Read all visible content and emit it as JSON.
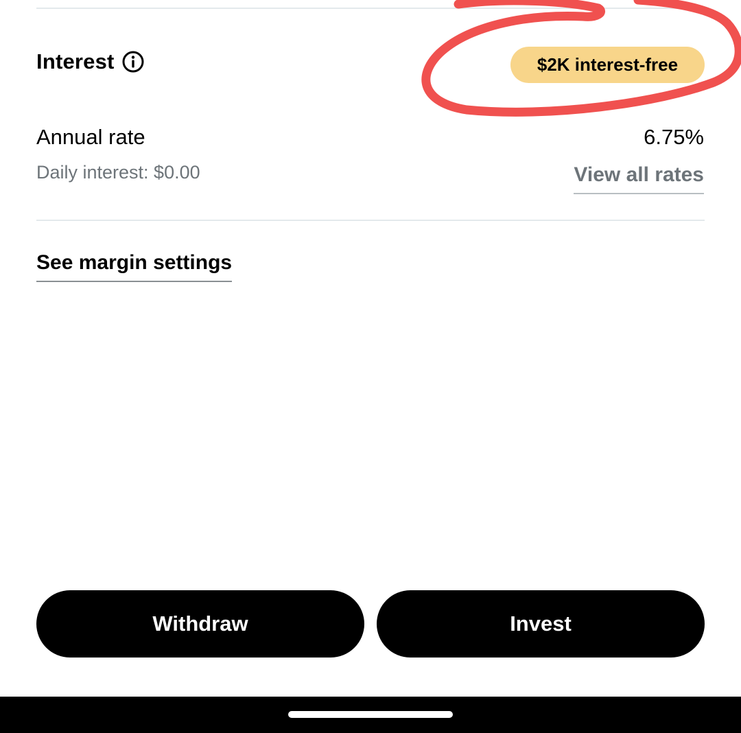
{
  "interest": {
    "title": "Interest",
    "info_icon": "info-icon",
    "badge": "$2K interest-free"
  },
  "rates": {
    "annual_label": "Annual rate",
    "annual_value": "6.75%",
    "daily_interest": "Daily interest: $0.00",
    "view_all_link": "View all rates"
  },
  "margin": {
    "settings_link": "See margin settings"
  },
  "actions": {
    "withdraw_label": "Withdraw",
    "invest_label": "Invest"
  },
  "colors": {
    "badge_bg": "#f8d58a",
    "annotation_red": "#f0514f",
    "muted_text": "#6d7479",
    "button_bg": "#000000"
  }
}
